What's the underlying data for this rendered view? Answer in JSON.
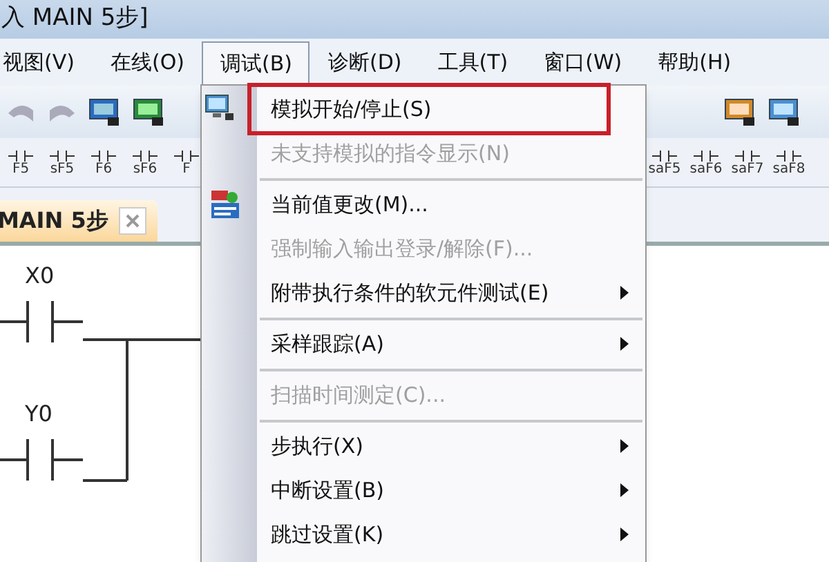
{
  "window": {
    "title": "入 MAIN 5步]"
  },
  "menubar": [
    {
      "label": "视图(V)",
      "selected": false
    },
    {
      "label": "在线(O)",
      "selected": false
    },
    {
      "label": "调试(B)",
      "selected": true
    },
    {
      "label": "诊断(D)",
      "selected": false
    },
    {
      "label": "工具(T)",
      "selected": false
    },
    {
      "label": "窗口(W)",
      "selected": false
    },
    {
      "label": "帮助(H)",
      "selected": false
    }
  ],
  "function_keys_left": [
    "F5",
    "sF5",
    "F6",
    "sF6",
    "F"
  ],
  "function_keys_right": [
    "saF5",
    "saF6",
    "saF7",
    "saF8"
  ],
  "tab": {
    "label": "MAIN 5步"
  },
  "ladder": [
    {
      "label": "X0"
    },
    {
      "label": "Y0"
    }
  ],
  "menu": [
    {
      "kind": "monitor-item",
      "label": "模拟开始/停止(S)",
      "disabled": false,
      "submenu": false,
      "annotated": true
    },
    {
      "kind": "item",
      "label": "未支持模拟的指令显示(N)",
      "disabled": true,
      "submenu": false,
      "annotated": false
    },
    {
      "kind": "separator"
    },
    {
      "kind": "dev-item",
      "label": "当前值更改(M)...",
      "disabled": false,
      "submenu": false,
      "annotated": false
    },
    {
      "kind": "item",
      "label": "强制输入输出登录/解除(F)...",
      "disabled": true,
      "submenu": false,
      "annotated": false
    },
    {
      "kind": "item",
      "label": "附带执行条件的软元件测试(E)",
      "disabled": false,
      "submenu": true,
      "annotated": false
    },
    {
      "kind": "separator"
    },
    {
      "kind": "item",
      "label": "采样跟踪(A)",
      "disabled": false,
      "submenu": true,
      "annotated": false
    },
    {
      "kind": "separator"
    },
    {
      "kind": "item",
      "label": "扫描时间测定(C)...",
      "disabled": true,
      "submenu": false,
      "annotated": false
    },
    {
      "kind": "separator"
    },
    {
      "kind": "item",
      "label": "步执行(X)",
      "disabled": false,
      "submenu": true,
      "annotated": false
    },
    {
      "kind": "item",
      "label": "中断设置(B)",
      "disabled": false,
      "submenu": true,
      "annotated": false
    },
    {
      "kind": "item",
      "label": "跳过设置(K)",
      "disabled": false,
      "submenu": true,
      "annotated": false
    }
  ]
}
